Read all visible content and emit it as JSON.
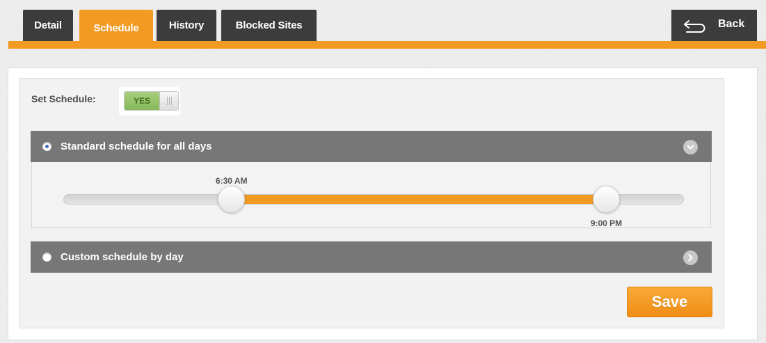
{
  "tabs": [
    {
      "label": "Detail",
      "active": false
    },
    {
      "label": "Schedule",
      "active": true
    },
    {
      "label": "History",
      "active": false
    },
    {
      "label": "Blocked Sites",
      "active": false
    }
  ],
  "back_button": {
    "label": "Back",
    "icon": "return-arrow-icon"
  },
  "set_schedule": {
    "label": "Set Schedule:",
    "toggle_value": "YES",
    "enabled": true
  },
  "standard_schedule": {
    "label": "Standard schedule for all days",
    "selected": true,
    "expanded": true,
    "icon": "chevron-down-icon",
    "slider": {
      "day_start": "12:00 AM",
      "day_end": "12:00 AM",
      "start": {
        "label": "6:30 AM",
        "value_fraction": 0.271
      },
      "end": {
        "label": "9:00 PM",
        "value_fraction": 0.875
      },
      "fill_color": "#f29a22"
    }
  },
  "custom_schedule": {
    "label": "Custom schedule by day",
    "selected": false,
    "expanded": false,
    "icon": "chevron-right-icon"
  },
  "save_button": {
    "label": "Save"
  },
  "colors": {
    "accent": "#f29a22",
    "tab_bg": "#3c3c3c",
    "header_bg": "#777777",
    "toggle_on": "#8fc163"
  }
}
